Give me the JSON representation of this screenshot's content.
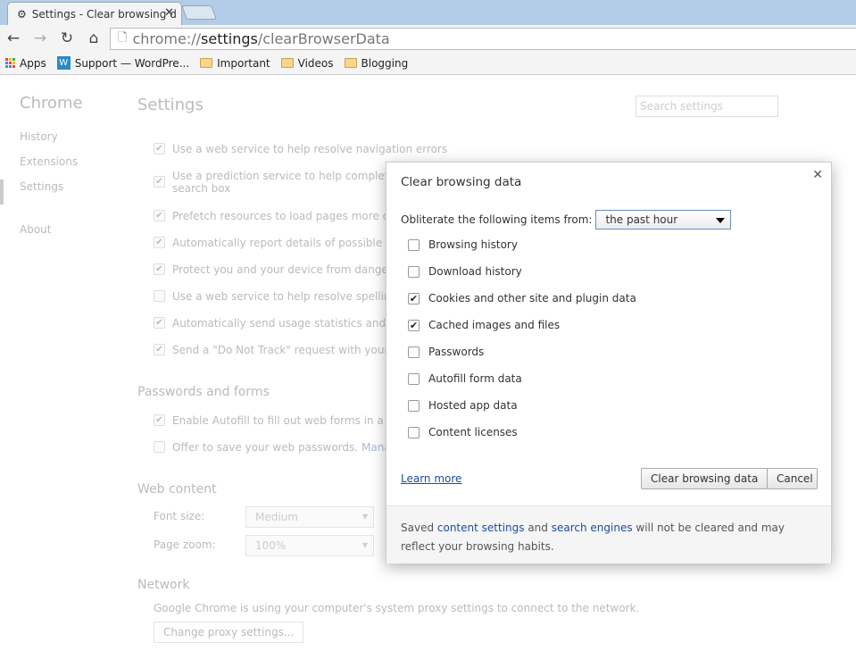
{
  "tab": {
    "title": "Settings - Clear browsing d"
  },
  "omnibox": {
    "scheme": "chrome://",
    "host": "settings",
    "path": "/clearBrowserData"
  },
  "bookmarks": [
    {
      "label": "Apps",
      "icon": "apps-grid-icon"
    },
    {
      "label": "Support — WordPre...",
      "icon": "wordpress-icon"
    },
    {
      "label": "Important",
      "icon": "folder-icon"
    },
    {
      "label": "Videos",
      "icon": "folder-icon"
    },
    {
      "label": "Blogging",
      "icon": "folder-icon"
    }
  ],
  "sidebar": {
    "brand": "Chrome",
    "items": [
      "History",
      "Extensions",
      "Settings",
      "About"
    ]
  },
  "settings": {
    "title": "Settings",
    "search_placeholder": "Search settings",
    "privacy": [
      {
        "text": "Use a web service to help resolve navigation errors",
        "checked": true
      },
      {
        "text": "Use a prediction service to help complete sea",
        "text2": "search box",
        "checked": true
      },
      {
        "text": "Prefetch resources to load pages more quickl",
        "checked": true
      },
      {
        "text": "Automatically report details of possible secur",
        "checked": true
      },
      {
        "text": "Protect you and your device from dangerous",
        "checked": true
      },
      {
        "text": "Use a web service to help resolve spelling err",
        "checked": false
      },
      {
        "text": "Automatically send usage statistics and crash",
        "checked": true
      },
      {
        "text": "Send a \"Do Not Track\" request with your bro",
        "checked": true
      }
    ],
    "passwords_title": "Passwords and forms",
    "autofill": "Enable Autofill to fill out web forms in a singl",
    "offer_save": "Offer to save your web passwords.",
    "manage": "Manage p",
    "web_content_title": "Web content",
    "font_size_label": "Font size:",
    "font_size": "Medium",
    "page_zoom_label": "Page zoom:",
    "page_zoom": "100%",
    "network_title": "Network",
    "network_text": "Google Chrome is using your computer's system proxy settings to connect to the network.",
    "proxy_button": "Change proxy settings..."
  },
  "dialog": {
    "title": "Clear browsing data",
    "obliterate_label": "Obliterate the following items from:",
    "period": "the past hour",
    "items": [
      {
        "label": "Browsing history",
        "checked": false
      },
      {
        "label": "Download history",
        "checked": false
      },
      {
        "label": "Cookies and other site and plugin data",
        "checked": true
      },
      {
        "label": "Cached images and files",
        "checked": true
      },
      {
        "label": "Passwords",
        "checked": false
      },
      {
        "label": "Autofill form data",
        "checked": false
      },
      {
        "label": "Hosted app data",
        "checked": false
      },
      {
        "label": "Content licenses",
        "checked": false
      }
    ],
    "learn_more": "Learn more",
    "clear_button": "Clear browsing data",
    "cancel_button": "Cancel",
    "footer": {
      "pre": "Saved ",
      "link1": "content settings",
      "mid": " and ",
      "link2": "search engines",
      "post": " will not be cleared and may reflect your browsing habits."
    }
  }
}
